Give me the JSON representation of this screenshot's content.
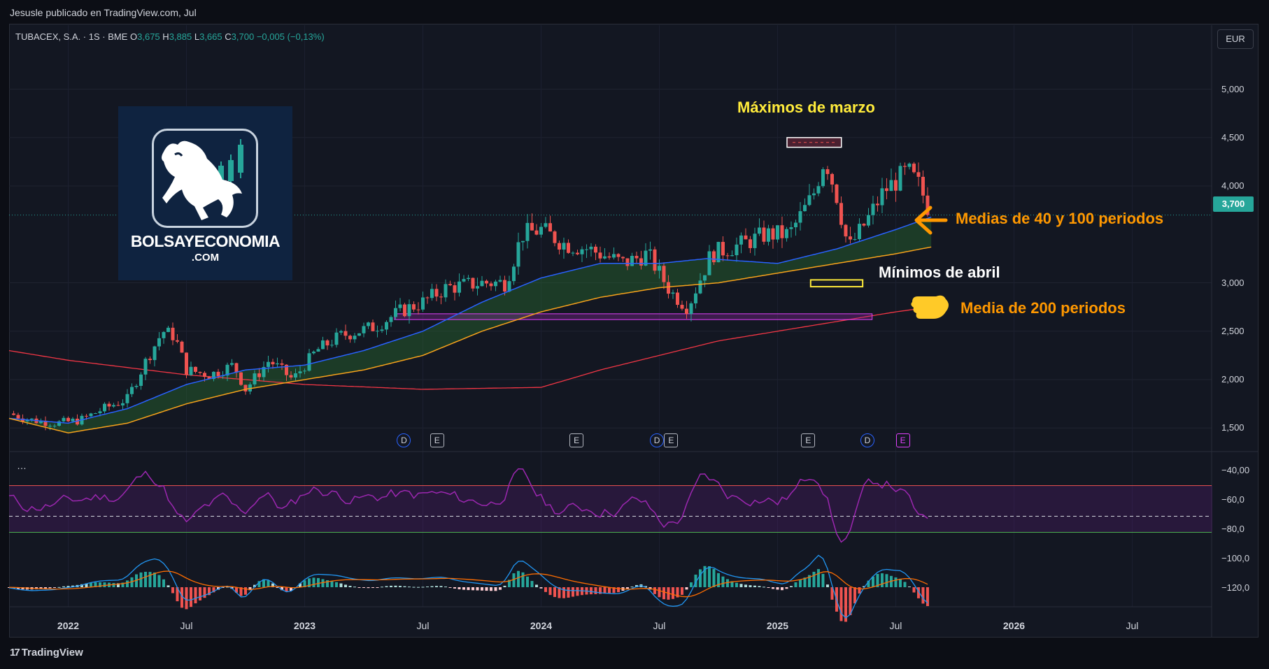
{
  "header": {
    "publisher": "Jesusle publicado en TradingView.com, Jul"
  },
  "legend": {
    "symbol": "TUBACEX, S.A. · 1S · BME",
    "open_label": "O",
    "open": "3,675",
    "high_label": "H",
    "high": "3,885",
    "low_label": "L",
    "low": "3,665",
    "close_label": "C",
    "close": "3,700",
    "change": "−0,005 (−0,13%)"
  },
  "currency": "EUR",
  "last_price": "3,700",
  "footer": {
    "brand": "TradingView"
  },
  "logo": {
    "line1": "BOLSAYECONOMIA",
    "line2": ".COM"
  },
  "annotations": {
    "max_march": "Máximos de marzo",
    "min_april": "Mínimos de abril",
    "ma_40_100": "Medias de 40 y 100 periodos",
    "ma_200": "Media de 200 periodos"
  },
  "indicator_dots": "…",
  "colors": {
    "up": "#26a69a",
    "down": "#ef5350",
    "ma40": "#2962ff",
    "ma100": "#f7a21b",
    "ma200": "#f23645",
    "rsi": "#9c27b0",
    "anno_yellow": "#ffeb3b",
    "anno_orange": "#ff9800"
  },
  "chart_data": [
    {
      "type": "candlestick",
      "title": "TUBACEX, S.A. · 1S · BME",
      "x_ticks": [
        "2022",
        "Jul",
        "2023",
        "Jul",
        "2024",
        "Jul",
        "2025",
        "Jul",
        "2026",
        "Jul"
      ],
      "x_tick_years": [
        2022.0,
        2022.5,
        2023.0,
        2023.5,
        2024.0,
        2024.5,
        2025.0,
        2025.5,
        2026.0,
        2026.5
      ],
      "xlim": [
        2021.75,
        2026.83
      ],
      "y_ticks": [
        "5,000",
        "4,500",
        "4,000",
        "3,000",
        "2,500",
        "2,000",
        "1,500"
      ],
      "y_tick_values": [
        5.0,
        4.5,
        4.0,
        3.0,
        2.5,
        2.0,
        1.5
      ],
      "ylim": [
        1.3,
        5.3
      ],
      "close_approx": [
        [
          2021.75,
          1.65
        ],
        [
          2021.85,
          1.58
        ],
        [
          2021.95,
          1.55
        ],
        [
          2022.05,
          1.58
        ],
        [
          2022.15,
          1.7
        ],
        [
          2022.25,
          1.8
        ],
        [
          2022.33,
          2.2
        ],
        [
          2022.4,
          2.5
        ],
        [
          2022.45,
          2.45
        ],
        [
          2022.5,
          2.1
        ],
        [
          2022.6,
          2.05
        ],
        [
          2022.7,
          2.15
        ],
        [
          2022.75,
          1.9
        ],
        [
          2022.85,
          2.2
        ],
        [
          2022.95,
          2.0
        ],
        [
          2023.05,
          2.3
        ],
        [
          2023.15,
          2.45
        ],
        [
          2023.3,
          2.55
        ],
        [
          2023.4,
          2.7
        ],
        [
          2023.5,
          2.8
        ],
        [
          2023.6,
          2.95
        ],
        [
          2023.75,
          3.0
        ],
        [
          2023.85,
          3.0
        ],
        [
          2023.92,
          3.5
        ],
        [
          2024.0,
          3.55
        ],
        [
          2024.1,
          3.4
        ],
        [
          2024.2,
          3.35
        ],
        [
          2024.35,
          3.2
        ],
        [
          2024.45,
          3.3
        ],
        [
          2024.55,
          2.9
        ],
        [
          2024.62,
          2.75
        ],
        [
          2024.72,
          3.3
        ],
        [
          2024.85,
          3.4
        ],
        [
          2024.95,
          3.5
        ],
        [
          2025.05,
          3.5
        ],
        [
          2025.15,
          3.9
        ],
        [
          2025.2,
          4.3
        ],
        [
          2025.25,
          3.9
        ],
        [
          2025.3,
          3.35
        ],
        [
          2025.38,
          3.65
        ],
        [
          2025.45,
          3.95
        ],
        [
          2025.55,
          4.15
        ],
        [
          2025.6,
          4.0
        ],
        [
          2025.65,
          3.7
        ]
      ],
      "ma40_approx": [
        [
          2021.75,
          1.6
        ],
        [
          2022.0,
          1.55
        ],
        [
          2022.25,
          1.7
        ],
        [
          2022.5,
          1.95
        ],
        [
          2022.75,
          2.1
        ],
        [
          2023.0,
          2.15
        ],
        [
          2023.25,
          2.3
        ],
        [
          2023.5,
          2.5
        ],
        [
          2023.75,
          2.8
        ],
        [
          2024.0,
          3.05
        ],
        [
          2024.25,
          3.2
        ],
        [
          2024.5,
          3.2
        ],
        [
          2024.7,
          3.25
        ],
        [
          2025.0,
          3.2
        ],
        [
          2025.25,
          3.35
        ],
        [
          2025.5,
          3.55
        ],
        [
          2025.65,
          3.68
        ]
      ],
      "ma100_approx": [
        [
          2021.75,
          1.6
        ],
        [
          2022.0,
          1.45
        ],
        [
          2022.25,
          1.55
        ],
        [
          2022.5,
          1.75
        ],
        [
          2022.75,
          1.9
        ],
        [
          2023.0,
          2.0
        ],
        [
          2023.25,
          2.1
        ],
        [
          2023.5,
          2.25
        ],
        [
          2023.75,
          2.5
        ],
        [
          2024.0,
          2.7
        ],
        [
          2024.25,
          2.85
        ],
        [
          2024.5,
          2.95
        ],
        [
          2024.75,
          3.0
        ],
        [
          2025.0,
          3.1
        ],
        [
          2025.25,
          3.2
        ],
        [
          2025.5,
          3.3
        ],
        [
          2025.65,
          3.37
        ]
      ],
      "ma200_approx": [
        [
          2021.75,
          2.3
        ],
        [
          2022.0,
          2.2
        ],
        [
          2022.5,
          2.05
        ],
        [
          2023.0,
          1.95
        ],
        [
          2023.5,
          1.9
        ],
        [
          2024.0,
          1.92
        ],
        [
          2024.25,
          2.1
        ],
        [
          2024.5,
          2.25
        ],
        [
          2024.75,
          2.4
        ],
        [
          2025.0,
          2.5
        ],
        [
          2025.25,
          2.6
        ],
        [
          2025.5,
          2.7
        ],
        [
          2025.65,
          2.75
        ]
      ],
      "zones": [
        {
          "label": "Máximos de marzo",
          "y_range": [
            4.4,
            4.5
          ],
          "x_range": [
            2025.04,
            2025.27
          ]
        },
        {
          "label": "Mínimos de abril",
          "y_range": [
            2.96,
            3.03
          ],
          "x_range": [
            2025.14,
            2.0
          ]
        },
        {
          "label": "",
          "y_range": [
            2.62,
            2.68
          ],
          "x_range": [
            2023.38,
            2025.4
          ]
        }
      ],
      "events": [
        {
          "type": "D",
          "x": 2023.42
        },
        {
          "type": "E",
          "x": 2023.56
        },
        {
          "type": "E",
          "x": 2024.15
        },
        {
          "type": "D",
          "x": 2024.49
        },
        {
          "type": "E",
          "x": 2024.55
        },
        {
          "type": "E",
          "x": 2025.13
        },
        {
          "type": "D",
          "x": 2025.38
        },
        {
          "type": "E",
          "x": 2025.53
        }
      ]
    },
    {
      "type": "line",
      "title": "",
      "y_ticks": [
        "−40,00",
        "−60,0",
        "−80,0"
      ],
      "y_tick_values": [
        -40,
        -60,
        -80
      ],
      "ylim": [
        -88,
        -36
      ],
      "bands": [
        -51,
        -90
      ],
      "midline": -70
    },
    {
      "type": "histogram",
      "title": "",
      "y_ticks": [
        "−100,0",
        "−120,0"
      ],
      "y_tick_values": [
        -100,
        -120
      ]
    }
  ]
}
